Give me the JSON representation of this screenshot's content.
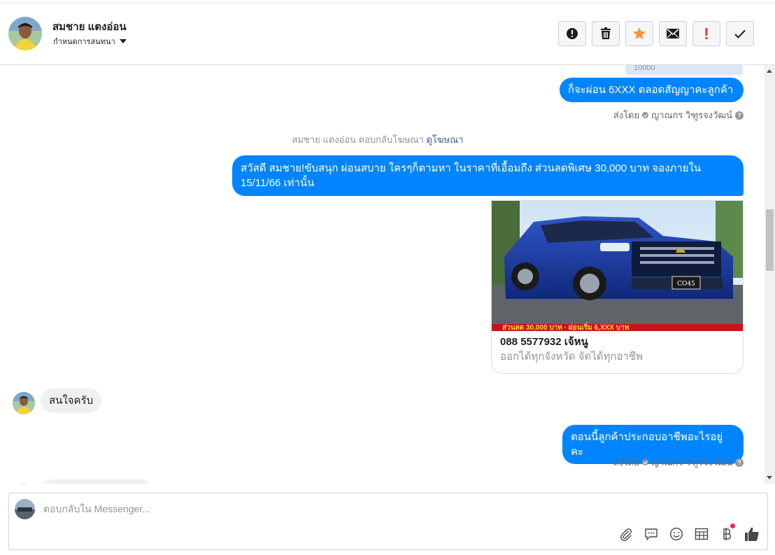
{
  "header": {
    "name": "สมชาย แตงอ่อน",
    "subtitle": "กำหนดการสนทนา",
    "toolbar": [
      {
        "name": "report-icon",
        "color": "#1c1e21"
      },
      {
        "name": "trash-icon",
        "color": "#1c1e21"
      },
      {
        "name": "star-icon",
        "color": "#f7923b"
      },
      {
        "name": "envelope-icon",
        "color": "#1c1e21"
      },
      {
        "name": "exclamation-icon",
        "color": "#e03b2a"
      },
      {
        "name": "checkmark-icon",
        "color": "#1c1e21"
      }
    ]
  },
  "thread": {
    "prev_card_text": "10000",
    "msg1": "ก็จะผ่อน 6XXX ตลอดสัญญาคะลูกค้า",
    "sentby1": {
      "prefix": "ส่งโดย",
      "agent": "ญาณกร วิฑูรจงวัฒน์"
    },
    "ad_reply_note": {
      "text": "สมชาย แตงอ่อน ตอบกลับโฆษณา",
      "link": "ดูโฆษณา"
    },
    "msg2": "สวัสดี สมชาย!ขับสนุก ผ่อนสบาย ใครๆก็ตามหา ในราคาที่เอื้อมถึง ส่วนลดพิเศษ 30,000 บาท จองภายใน 15/11/66 เท่านั้น",
    "ad": {
      "title": "088 5577932 เจ้หนู",
      "description": "ออกได้ทุกจังหวัด จัดได้ทุกอาชีพ",
      "plate": "CO45"
    },
    "msg3": "สนใจครับ",
    "msg4": "ตอนนี้ลูกค้าประกอบอาชีพอะไรอยู่คะ",
    "sentby2": {
      "prefix": "ส่งโดย",
      "agent": "ญาณกร วิฑูรจงวัฒน์"
    }
  },
  "composer": {
    "placeholder": "ตอบกลับใน Messenger...",
    "tools": [
      "paperclip-icon",
      "chat-bubble-icon",
      "emoji-icon",
      "table-icon",
      "baht-icon",
      "thumbs-up-icon"
    ]
  },
  "colors": {
    "accent": "#0084ff",
    "incoming_bubble": "#f0f0f0",
    "link": "#385898"
  }
}
